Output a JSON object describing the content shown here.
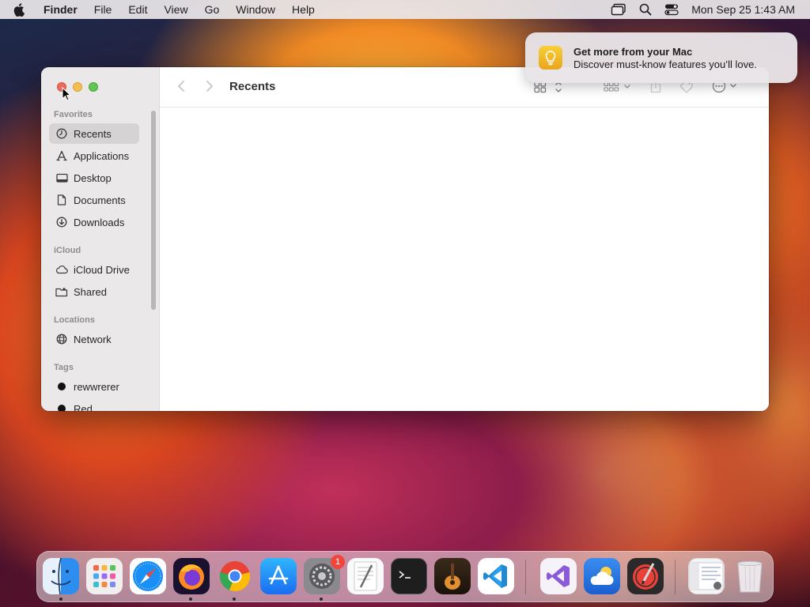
{
  "menubar": {
    "app_name": "Finder",
    "menus": [
      "File",
      "Edit",
      "View",
      "Go",
      "Window",
      "Help"
    ],
    "clock": "Mon Sep 25  1:43 AM"
  },
  "window": {
    "title": "Recents",
    "sidebar": {
      "favorites_title": "Favorites",
      "favorites": [
        "Recents",
        "Applications",
        "Desktop",
        "Documents",
        "Downloads"
      ],
      "icloud_title": "iCloud",
      "icloud": [
        "iCloud Drive",
        "Shared"
      ],
      "locations_title": "Locations",
      "locations": [
        "Network"
      ],
      "tags_title": "Tags",
      "tags": [
        "rewwrerer",
        "Red"
      ]
    }
  },
  "notification": {
    "title": "Get more from your Mac",
    "body": "Discover must-know features you’ll love."
  },
  "dock": {
    "system_settings_badge": "1"
  },
  "colors": {
    "accent_close": "#ed6a5e",
    "accent_minimize": "#f5bf4f",
    "accent_maximize": "#61c554"
  }
}
